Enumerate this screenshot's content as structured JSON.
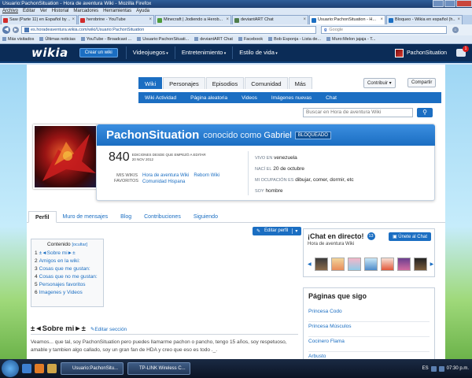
{
  "window": {
    "title": "Usuario:PachonSituation - Hora de aventura Wiki - Mozilla Firefox"
  },
  "menu": [
    "Archivo",
    "Editar",
    "Ver",
    "Historial",
    "Marcadores",
    "Herramientas",
    "Ayuda"
  ],
  "tabs": [
    {
      "label": "Saw (Parte 11) en Español by ...",
      "color": "#d12b2b"
    },
    {
      "label": "herobrine - YouTube",
      "color": "#d12b2b"
    },
    {
      "label": "Minecraft | Jodiendo a Herob...",
      "color": "#4d9b3a"
    },
    {
      "label": "deviantART Chat",
      "color": "#4f7d4b"
    },
    {
      "label": "Usuario:PachonSituation - H...",
      "color": "#1b6ec2"
    },
    {
      "label": "Bloqueo - Wikia en español (h...",
      "color": "#1b6ec2"
    }
  ],
  "url": "es.horadeaventura.wikia.com/wiki/Usuario:PachonSituation",
  "search_engine": "Google",
  "bookmarks": [
    "Más visitados",
    "Últimas noticias",
    "YouTube - Broadcast ...",
    "Usuario:PachonSituati...",
    "deviantART Chat",
    "Facebook",
    "Bob Esponja - Lista de...",
    "Muro:Melon jajaja - T..."
  ],
  "wikia": {
    "logo": "wikia",
    "crear": "Crear un wiki",
    "nav": [
      "Videojuegos",
      "Entretenimiento",
      "Estilo de vida"
    ],
    "user": "PachonSituation",
    "notifications": "1"
  },
  "wikinav": {
    "tabs": [
      "Wiki",
      "Personajes",
      "Episodios",
      "Comunidad",
      "Más"
    ],
    "sub": [
      "Wiki Actividad",
      "Página aleatoria",
      "Videos",
      "Imágenes nuevas",
      "Chat"
    ],
    "contribuir": "Contribuir",
    "compartir": "Compartir",
    "search_placeholder": "Buscar en Hora de aventura Wiki"
  },
  "profile": {
    "username": "PachonSituation",
    "aka_prefix": "conocido como",
    "aka_name": "Gabriel",
    "badge": "BLOQUEADO",
    "edits": "840",
    "edits_label1": "EDICIONES DESDE QUE EMPEZÓ A EDITAR",
    "edits_label2": "20 NOV 2012",
    "fav_label1": "MIS WIKIS",
    "fav_label2": "FAVORITOS",
    "favs": [
      "Hora de aventura Wiki",
      "Reborn Wiki",
      "Comunidad Hispana"
    ],
    "facts": [
      {
        "k": "VIVO EN",
        "v": "venezuela"
      },
      {
        "k": "NACÍ EL",
        "v": "20 de octubre"
      },
      {
        "k": "MI OCUPACIÓN ES",
        "v": "dibujar, comer, dormir, etc"
      },
      {
        "k": "SOY",
        "v": "hombre"
      }
    ]
  },
  "profile_tabs": [
    "Perfil",
    "Muro de mensajes",
    "Blog",
    "Contribuciones",
    "Siguiendo"
  ],
  "edit_profile": "Editar perfil",
  "toc": {
    "title": "Contenido",
    "hide": "[ocultar]",
    "items": [
      {
        "n": "1",
        "t": "±◄Sobre mi►±"
      },
      {
        "n": "2",
        "t": "Amigos en la wiki:"
      },
      {
        "n": "3",
        "t": "Cosas que me gustan:"
      },
      {
        "n": "4",
        "t": "Cosas que no me gustan:"
      },
      {
        "n": "5",
        "t": "Personajes favoritos"
      },
      {
        "n": "6",
        "t": "Imagenes y Videos"
      }
    ]
  },
  "section": {
    "heading": "±◄Sobre mi►±",
    "edit": "Editar sección",
    "text": "Veamos... que tal, soy PachonSituation pero puedes llamarme pachon o pancho, tengo 15 años, soy respetuoso, amable y tambien algo callado, soy un gran fan de HDA y creo que eso es todo ._."
  },
  "chat": {
    "title": "¡Chat en directo!",
    "count": "13",
    "join": "Únete al Chat",
    "wiki": "Hora de aventura Wiki"
  },
  "pages": {
    "title": "Páginas que sigo",
    "items": [
      "Princesa Codo",
      "Princesa Músculos",
      "Cocinero Flama",
      "Arbusto"
    ]
  },
  "taskbar": {
    "items": [
      "Usuario:PachonSitu...",
      "TP-LINK Wireless C..."
    ],
    "lang": "ES",
    "clock": "07:30 p.m."
  }
}
